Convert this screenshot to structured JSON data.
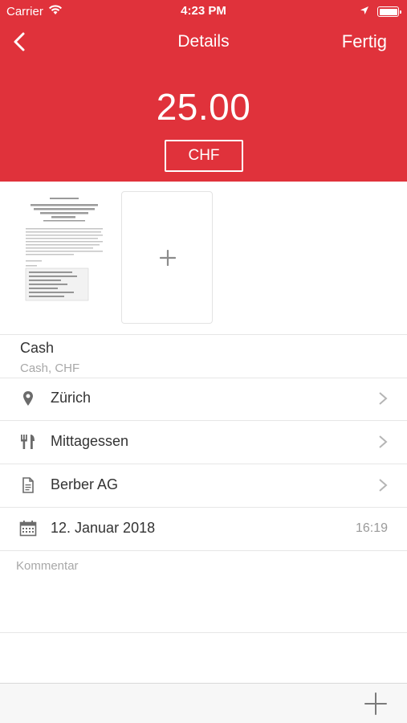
{
  "status_bar": {
    "carrier": "Carrier",
    "time": "4:23 PM"
  },
  "nav": {
    "title": "Details",
    "done_label": "Fertig"
  },
  "expense": {
    "amount": "25.00",
    "currency": "CHF"
  },
  "payment": {
    "title": "Cash",
    "subtitle": "Cash, CHF"
  },
  "rows": [
    {
      "label": "Zürich",
      "icon": "location-pin-icon"
    },
    {
      "label": "Mittagessen",
      "icon": "fork-knife-icon"
    },
    {
      "label": "Berber AG",
      "icon": "document-icon"
    },
    {
      "label": "12. Januar 2018",
      "icon": "calendar-icon",
      "value": "16:19"
    }
  ],
  "comment": {
    "placeholder": "Kommentar"
  },
  "colors": {
    "accent": "#e0323b",
    "text": "#333333",
    "secondary": "#a8a8a8"
  }
}
